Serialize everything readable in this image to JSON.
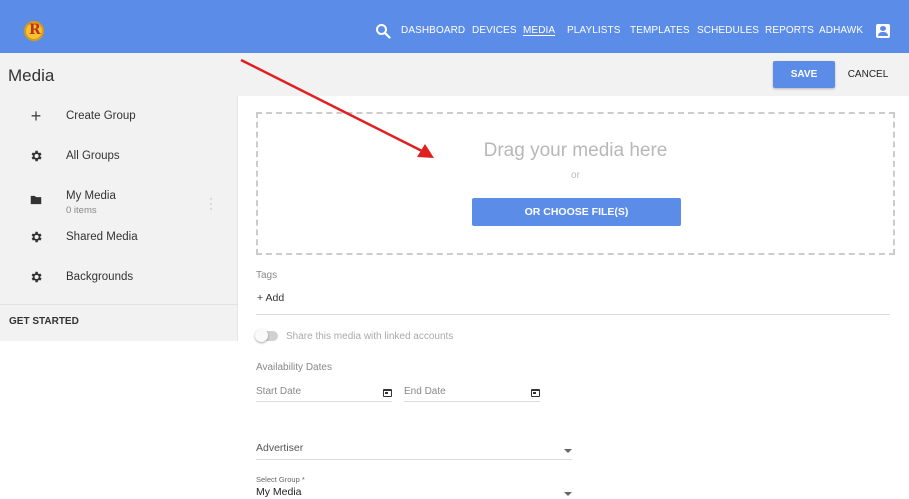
{
  "app": {
    "logo_letter": "R",
    "nav": [
      "DASHBOARD",
      "DEVICES",
      "MEDIA",
      "PLAYLISTS",
      "TEMPLATES",
      "SCHEDULES",
      "REPORTS",
      "ADHAWK"
    ],
    "active_nav": "MEDIA",
    "accent_color": "#5b8de8"
  },
  "page": {
    "title": "Media",
    "save_label": "SAVE",
    "cancel_label": "CANCEL"
  },
  "sidebar": {
    "items": [
      {
        "label": "Create Group",
        "icon": "plus-icon"
      },
      {
        "label": "All Groups",
        "icon": "gear-icon"
      },
      {
        "label": "My Media",
        "sub": "0 items",
        "icon": "folder-icon"
      },
      {
        "label": "Shared Media",
        "icon": "gear-icon"
      },
      {
        "label": "Backgrounds",
        "icon": "gear-icon"
      }
    ],
    "get_started": "GET STARTED"
  },
  "upload": {
    "drop_text": "Drag your media here",
    "or_text": "or",
    "choose_label": "OR CHOOSE FILE(S)"
  },
  "form": {
    "tags_label": "Tags",
    "add_tag": "+ Add",
    "share_label": "Share this media with linked accounts",
    "share_enabled": false,
    "availability_label": "Availability Dates",
    "start_date_placeholder": "Start Date",
    "end_date_placeholder": "End Date",
    "advertiser_placeholder": "Advertiser",
    "group_label": "Select Group *",
    "group_value": "My Media"
  }
}
